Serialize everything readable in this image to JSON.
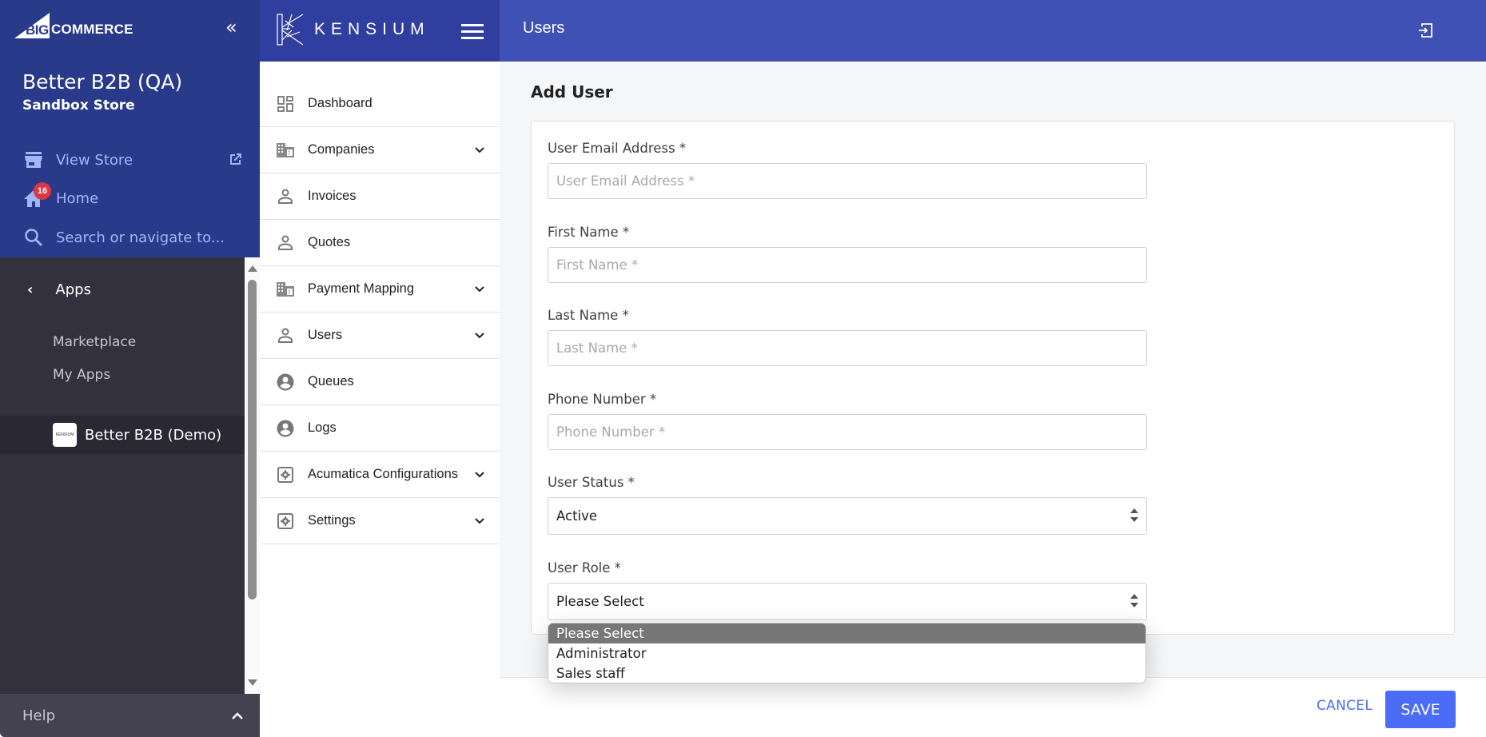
{
  "bigcommerce": {
    "logo_big": "BIG",
    "logo_commerce": "COMMERCE",
    "collapse_glyph": "«",
    "store_name": "Better B2B (QA)",
    "store_subtitle": "Sandbox Store",
    "links": {
      "view_store": "View Store",
      "home": "Home",
      "home_badge": "16",
      "search_placeholder": "Search or navigate to..."
    },
    "apps": {
      "header": "Apps",
      "back_glyph": "‹",
      "items": [
        "Marketplace",
        "My Apps"
      ],
      "active_app": "Better B2B (Demo)",
      "active_app_thumb": "KENSIUM"
    },
    "help": {
      "label": "Help",
      "chevron": "⌃"
    }
  },
  "kensium": {
    "brand": "KENSIUM",
    "nav": [
      {
        "label": "Dashboard",
        "icon": "dashboard-icon",
        "expandable": false
      },
      {
        "label": "Companies",
        "icon": "building-icon",
        "expandable": true
      },
      {
        "label": "Invoices",
        "icon": "person-icon",
        "expandable": false
      },
      {
        "label": "Quotes",
        "icon": "person-icon",
        "expandable": false
      },
      {
        "label": "Payment Mapping",
        "icon": "building-icon",
        "expandable": true
      },
      {
        "label": "Users",
        "icon": "person-icon",
        "expandable": true
      },
      {
        "label": "Queues",
        "icon": "account-circle-icon",
        "expandable": false
      },
      {
        "label": "Logs",
        "icon": "account-circle-icon",
        "expandable": false
      },
      {
        "label": "Acumatica Configurations",
        "icon": "settings-box-icon",
        "expandable": true
      },
      {
        "label": "Settings",
        "icon": "settings-box-icon",
        "expandable": true
      }
    ]
  },
  "main": {
    "header_title": "Users",
    "page_heading": "Add User",
    "form": {
      "email": {
        "label": "User Email Address *",
        "placeholder": "User Email Address *",
        "value": ""
      },
      "first_name": {
        "label": "First Name *",
        "placeholder": "First Name *",
        "value": ""
      },
      "last_name": {
        "label": "Last Name *",
        "placeholder": "Last Name *",
        "value": ""
      },
      "phone": {
        "label": "Phone Number *",
        "placeholder": "Phone Number *",
        "value": ""
      },
      "status": {
        "label": "User Status *",
        "value": "Active"
      },
      "role": {
        "label": "User Role *",
        "value": "Please Select",
        "options": [
          "Please Select",
          "Administrator",
          "Sales staff"
        ],
        "highlighted_option": "Please Select"
      }
    },
    "footer": {
      "cancel_label": "CANCEL",
      "save_label": "SAVE"
    }
  },
  "colors": {
    "bc_blue": "#293a8a",
    "kensium_blue": "#303f9f",
    "header_blue": "#3f51b5",
    "primary_button": "#4a6cf7",
    "badge_red": "#db3643"
  }
}
